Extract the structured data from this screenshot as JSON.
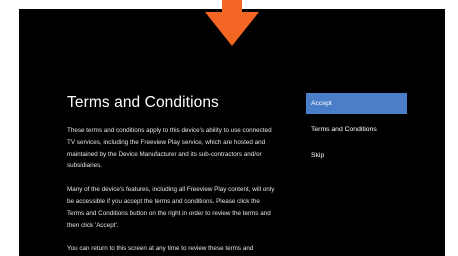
{
  "colors": {
    "arrow": "#f26522",
    "screen_background": "#000000",
    "selected_highlight": "#4a7ec8",
    "text": "#ffffff"
  },
  "pointer_icon": "down-arrow",
  "terms": {
    "title": "Terms and Conditions",
    "paragraphs": [
      "These terms and conditions apply to this device's ability to use connected TV services, including the Freeview Play service, which are hosted and maintained by the Device Manufacturer and its sub-contractors and/or subsidiaries.",
      "Many of the device's features, including all Freeview Play content, will only be accessible if you accept the terms and conditions. Please click the Terms and Conditions button on the right in order to review the terms and then click 'Accept'.",
      "You can return to this screen at any time to review these terms and conditions."
    ]
  },
  "menu": {
    "selected_item": "Accept",
    "items": [
      {
        "label": "Accept"
      },
      {
        "label": "Terms and Conditions"
      },
      {
        "label": "Skip"
      }
    ]
  }
}
